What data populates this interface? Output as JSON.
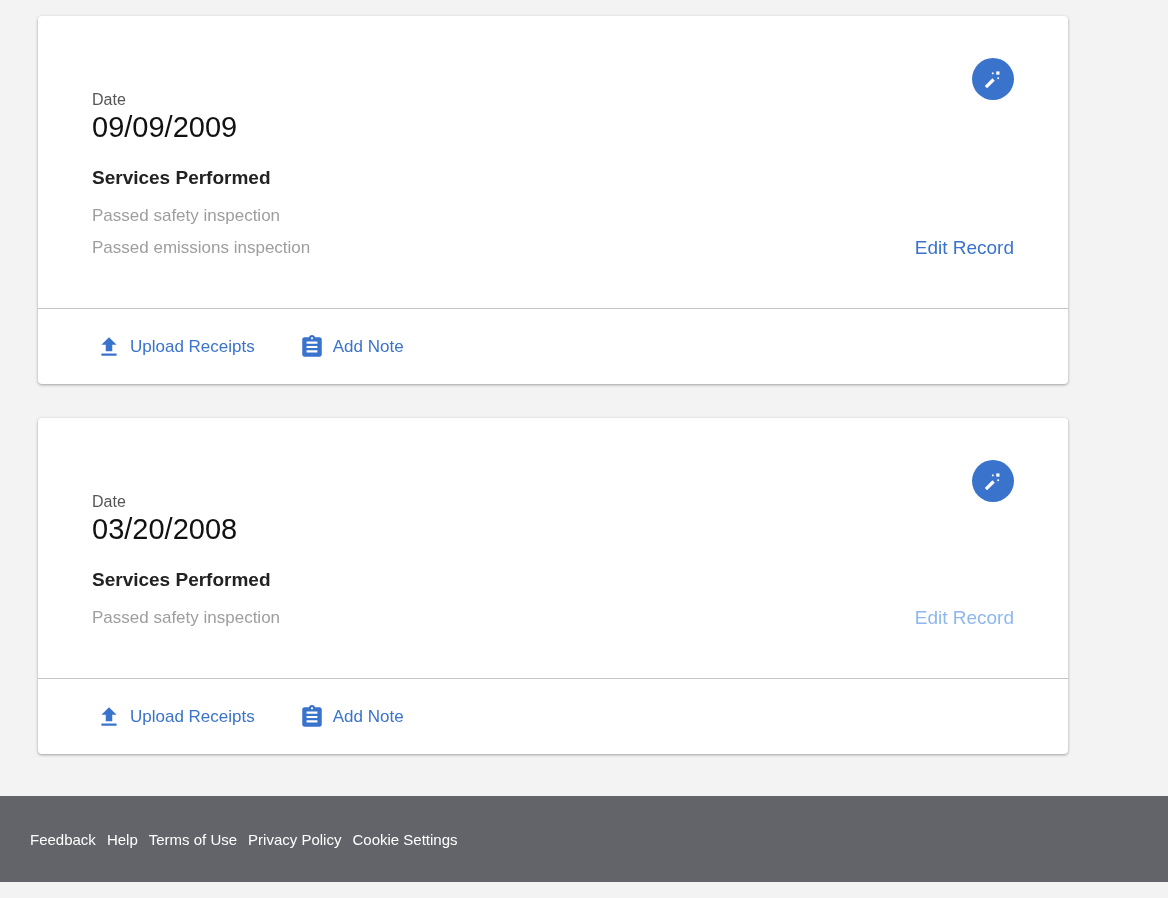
{
  "records": [
    {
      "date_label": "Date",
      "date": "09/09/2009",
      "services_heading": "Services Performed",
      "services": [
        "Passed safety inspection",
        "Passed emissions inspection"
      ],
      "edit_link": {
        "label": "Edit Record",
        "disabled": false
      },
      "actions": [
        {
          "kind": "upload",
          "label": "Upload Receipts"
        },
        {
          "kind": "note",
          "label": "Add Note"
        }
      ]
    },
    {
      "date_label": "Date",
      "date": "03/20/2008",
      "services_heading": "Services Performed",
      "services": [
        "Passed safety inspection"
      ],
      "edit_link": {
        "label": "Edit Record",
        "disabled": true
      },
      "actions": [
        {
          "kind": "upload",
          "label": "Upload Receipts"
        },
        {
          "kind": "note",
          "label": "Add Note"
        }
      ]
    }
  ],
  "footer": {
    "links": [
      "Feedback",
      "Help",
      "Terms of Use",
      "Privacy Policy",
      "Cookie Settings"
    ]
  }
}
